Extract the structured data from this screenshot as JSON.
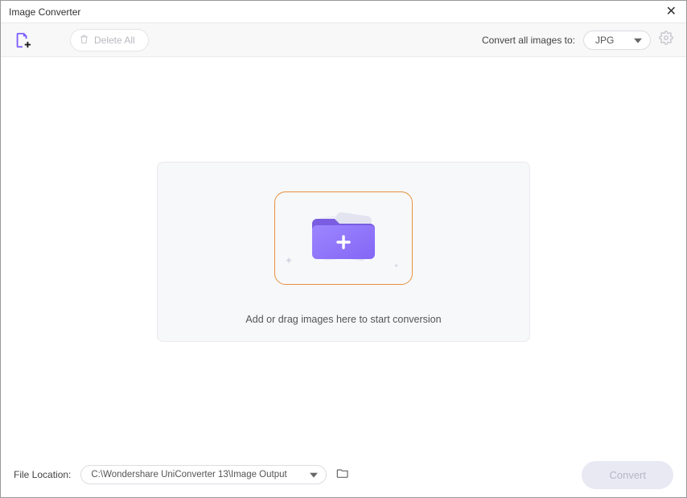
{
  "window": {
    "title": "Image Converter"
  },
  "toolbar": {
    "delete_all_label": "Delete All",
    "convert_all_label": "Convert all images to:",
    "format_selected": "JPG"
  },
  "dropzone": {
    "instruction": "Add or drag images here to start conversion"
  },
  "footer": {
    "file_location_label": "File Location:",
    "output_path": "C:\\Wondershare UniConverter 13\\Image Output",
    "convert_button_label": "Convert"
  }
}
